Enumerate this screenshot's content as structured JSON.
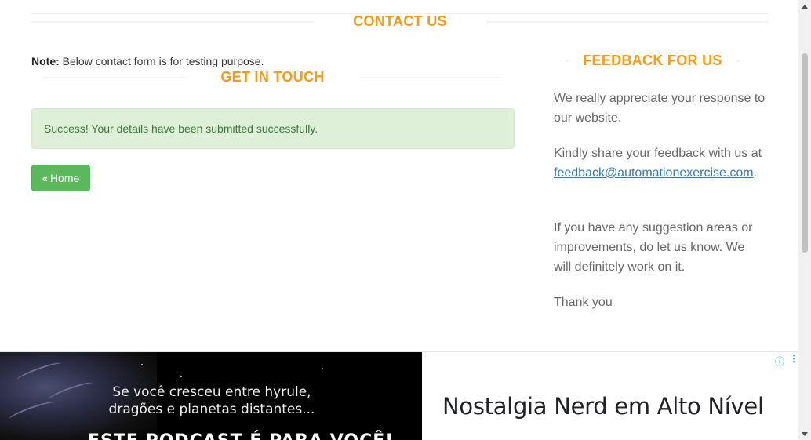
{
  "contact": {
    "title": "CONTACT US",
    "note_label": "Note:",
    "note_text": " Below contact form is for testing purpose."
  },
  "get_in_touch": {
    "title": "GET IN TOUCH",
    "success_message": "Success! Your details have been submitted successfully.",
    "home_button": "Home",
    "home_icon": "«"
  },
  "feedback": {
    "title": "FEEDBACK FOR US",
    "p1": "We really appreciate your response to our website.",
    "p2_text": "Kindly share your feedback with us at",
    "p2_email": "feedback@automationexercise.com",
    "p2_end": ".",
    "p3": "If you have any suggestion areas or improvements, do let us know. We will definitely work on it.",
    "p4": "Thank you"
  },
  "ad": {
    "line1": "Se você cresceu entre hyrule,",
    "line2": "dragões e planetas distantes...",
    "big_text": "ESTE PODCAST É PARA VOCÊ!",
    "headline": "Nostalgia Nerd em Alto Nível",
    "info_icon": "ⓘ",
    "menu_icon": "⋮"
  },
  "colors": {
    "accent": "#FE980F",
    "success_bg": "#dff0d8",
    "success_text": "#3c763d",
    "button": "#5cb85c",
    "link": "#337ab7"
  }
}
